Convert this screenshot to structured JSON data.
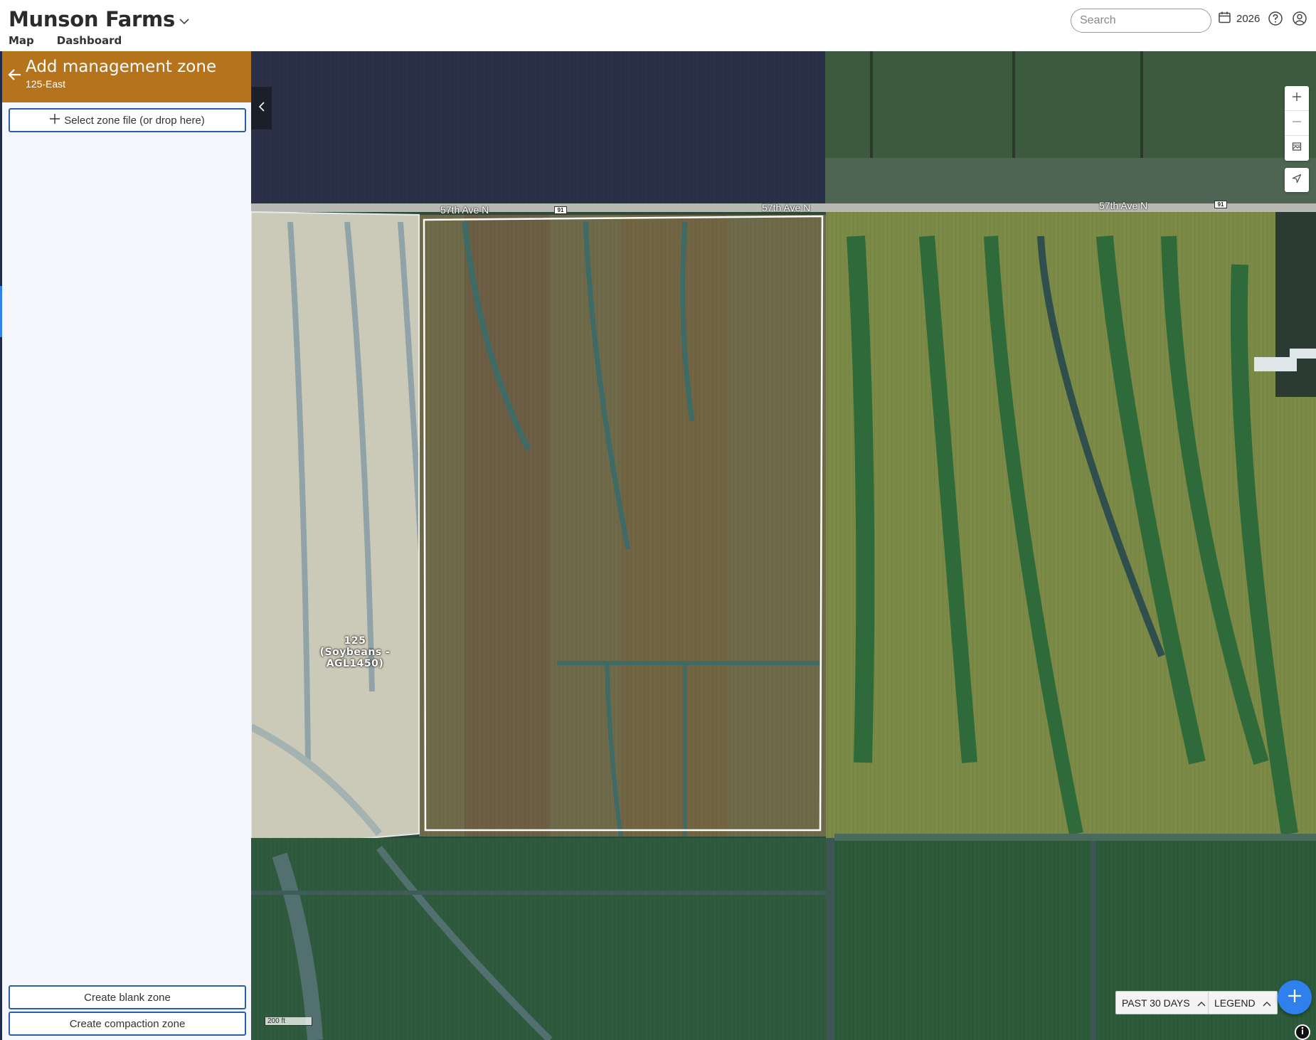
{
  "header": {
    "farm_name": "Munson Farms",
    "tabs": [
      {
        "label": "Map",
        "active": true
      },
      {
        "label": "Dashboard",
        "active": false
      }
    ],
    "search_placeholder": "Search",
    "year": "2026",
    "icons": [
      "chevron-down-icon",
      "calendar-icon",
      "help-icon",
      "user-icon"
    ]
  },
  "panel": {
    "title": "Add management zone",
    "subtitle": "125-East",
    "select_file_label": "Select zone file (or drop here)",
    "create_blank_label": "Create blank zone",
    "create_compaction_label": "Create compaction zone",
    "header_color": "#b5731b"
  },
  "map": {
    "road_labels": [
      "57th Ave N",
      "57th Ave N",
      "57th Ave N"
    ],
    "route_shields": [
      "91",
      "91"
    ],
    "field_label": {
      "line1": "125",
      "line2": "(Soybeans -",
      "line3": "AGL1450)"
    },
    "scale_label": "200 ft",
    "past_label": "PAST 30 DAYS",
    "legend_label": "LEGEND",
    "accent_color": "#2f80ed"
  }
}
